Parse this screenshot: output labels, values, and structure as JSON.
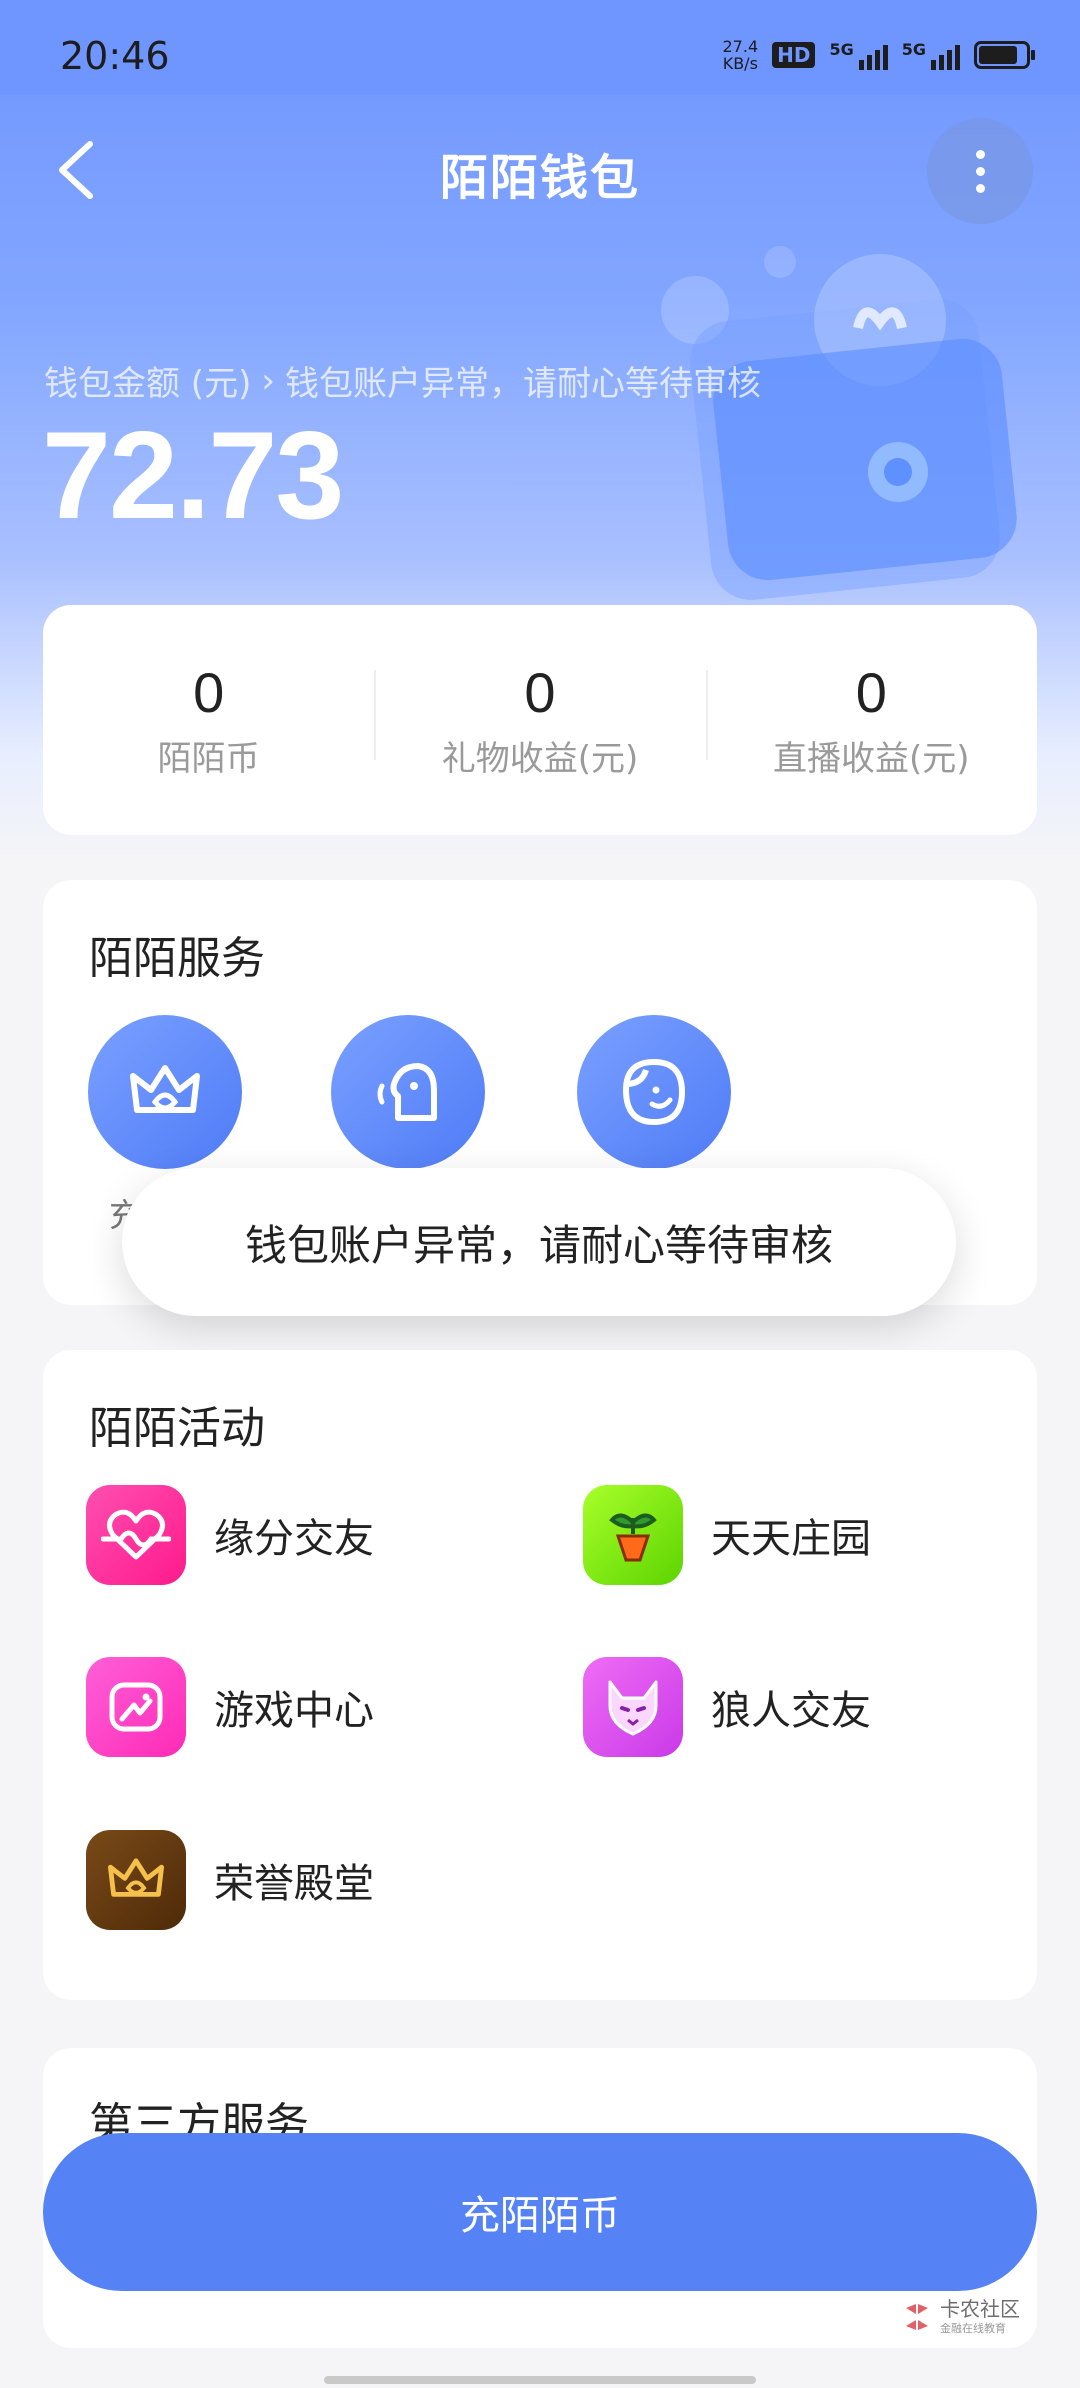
{
  "status_bar": {
    "time": "20:46",
    "net_speed_value": "27.4",
    "net_speed_unit": "KB/s",
    "hd_label": "HD",
    "sim1_label": "5G",
    "sim2_label": "5G"
  },
  "nav": {
    "title": "陌陌钱包",
    "back_icon": "back-chevron",
    "more_icon": "vertical-dots"
  },
  "wallet": {
    "balance_label": "钱包金额 (元)",
    "status_message": "钱包账户异常，请耐心等待审核",
    "balance": "72.73"
  },
  "stats": [
    {
      "value": "0",
      "label": "陌陌币"
    },
    {
      "value": "0",
      "label": "礼物收益(元)"
    },
    {
      "value": "0",
      "label": "直播收益(元)"
    }
  ],
  "services": {
    "title": "陌陌服务",
    "items": [
      {
        "icon": "crown-icon",
        "label": "充"
      },
      {
        "icon": "speech-head-icon",
        "label": ""
      },
      {
        "icon": "face-icon",
        "label": ""
      }
    ]
  },
  "toast": {
    "message": "钱包账户异常，请耐心等待审核"
  },
  "activities": {
    "title": "陌陌活动",
    "items": [
      {
        "label": "缘分交友",
        "icon": "heart-icon",
        "color": "#ff2d9a"
      },
      {
        "label": "天天庄园",
        "icon": "sprout-carrot-icon",
        "color": "#7be000"
      },
      {
        "label": "游戏中心",
        "icon": "gamepad-icon",
        "color": "#ff3cc8"
      },
      {
        "label": "狼人交友",
        "icon": "wolf-icon",
        "color": "#e24bef"
      },
      {
        "label": "荣誉殿堂",
        "icon": "crown-icon",
        "color": "#6b3f12"
      }
    ]
  },
  "third_party": {
    "title": "第三方服务"
  },
  "cta": {
    "label": "充陌陌币"
  },
  "watermark": {
    "title": "卡农社区",
    "subtitle": "金融在线教育"
  },
  "colors": {
    "accent": "#5582f5",
    "header_top": "#6f95ff"
  }
}
